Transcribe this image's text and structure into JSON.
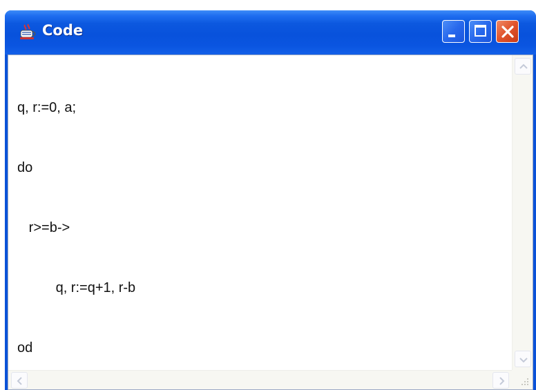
{
  "window": {
    "title": "Code",
    "icon": "java-cup-icon",
    "controls": [
      "minimize-icon",
      "maximize-icon",
      "close-icon"
    ]
  },
  "editor": {
    "lines": [
      "q, r:=0, a;",
      "do",
      "   r>=b->",
      "          q, r:=q+1, r-b",
      "od"
    ]
  },
  "colors": {
    "titlebar": "#0a55e0",
    "close_button": "#e0542c",
    "client_bg": "#ffffff",
    "text": "#111111"
  }
}
